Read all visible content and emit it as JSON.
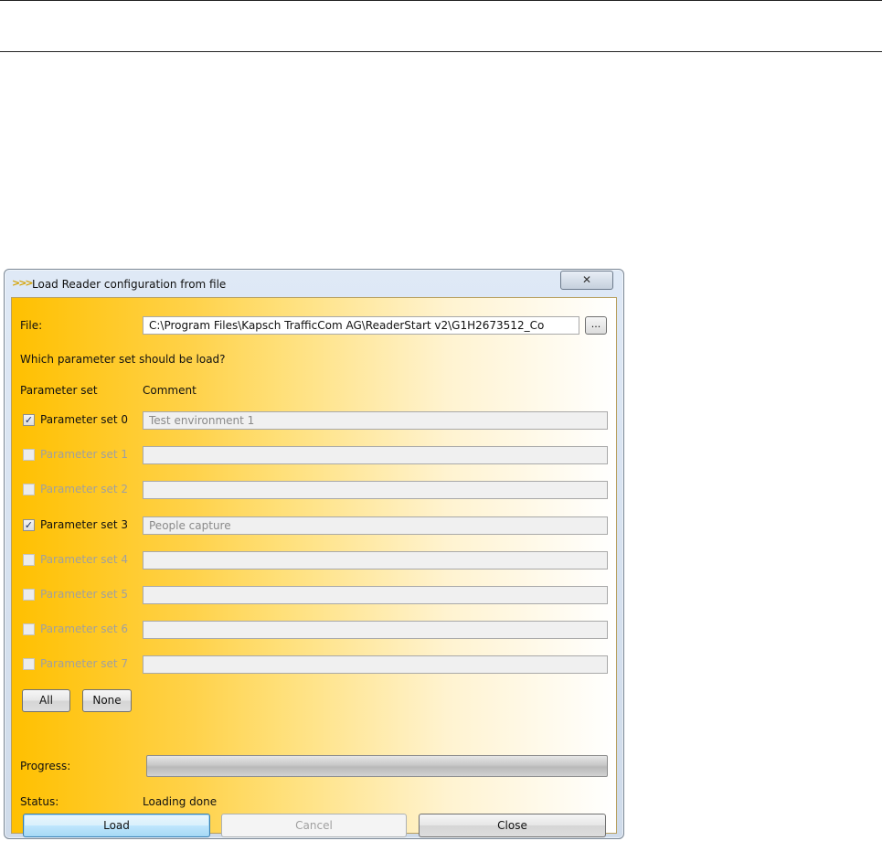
{
  "window": {
    "title": "Load Reader configuration from file",
    "close_glyph": "✕"
  },
  "file": {
    "label": "File:",
    "value": "C:\\Program Files\\Kapsch TrafficCom AG\\ReaderStart v2\\G1H2673512_Co",
    "browse_label": "..."
  },
  "question": "Which parameter set should be load?",
  "headers": {
    "parameter_set": "Parameter set",
    "comment": "Comment"
  },
  "parameter_sets": [
    {
      "label": "Parameter set 0",
      "checked": true,
      "enabled": true,
      "comment": "Test environment 1"
    },
    {
      "label": "Parameter set 1",
      "checked": false,
      "enabled": false,
      "comment": ""
    },
    {
      "label": "Parameter set 2",
      "checked": false,
      "enabled": false,
      "comment": ""
    },
    {
      "label": "Parameter set 3",
      "checked": true,
      "enabled": true,
      "comment": "People capture"
    },
    {
      "label": "Parameter set 4",
      "checked": false,
      "enabled": false,
      "comment": ""
    },
    {
      "label": "Parameter set 5",
      "checked": false,
      "enabled": false,
      "comment": ""
    },
    {
      "label": "Parameter set 6",
      "checked": false,
      "enabled": false,
      "comment": ""
    },
    {
      "label": "Parameter set 7",
      "checked": false,
      "enabled": false,
      "comment": ""
    }
  ],
  "select_buttons": {
    "all": "All",
    "none": "None"
  },
  "progress": {
    "label": "Progress:",
    "value": 0
  },
  "status": {
    "label": "Status:",
    "value": "Loading done"
  },
  "actions": {
    "load": "Load",
    "cancel": "Cancel",
    "close": "Close"
  }
}
